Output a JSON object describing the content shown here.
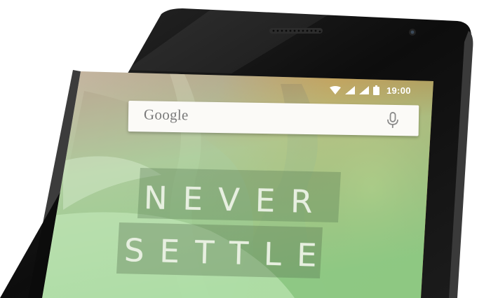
{
  "status_bar": {
    "time": "19:00",
    "icons": [
      "wifi-icon",
      "signal-icon",
      "signal-icon",
      "battery-icon"
    ]
  },
  "search_bar": {
    "brand": "Google",
    "icon": "microphone-icon"
  },
  "slogan": {
    "line1": "NEVER",
    "line2": "SETTLE"
  },
  "colors": {
    "phone_body": "#141414",
    "status_text": "#ffffff",
    "search_bg": "#fbfaf7",
    "wallpaper_orange": "#d9842a",
    "wallpaper_green": "#9ed39a",
    "slogan_text": "#e7efe0"
  }
}
